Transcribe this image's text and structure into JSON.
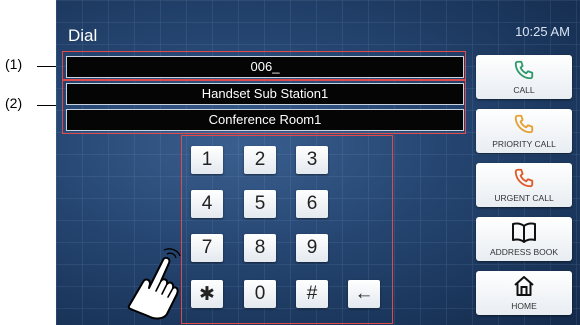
{
  "screen": {
    "title": "Dial",
    "time": "10:25 AM"
  },
  "fields": {
    "number": "006_",
    "station_name": "Handset Sub Station1",
    "room_name": "Conference Room1"
  },
  "callouts": {
    "label1": "(1)",
    "label2": "(2)"
  },
  "keypad": {
    "k1": "1",
    "k2": "2",
    "k3": "3",
    "k4": "4",
    "k5": "5",
    "k6": "6",
    "k7": "7",
    "k8": "8",
    "k9": "9",
    "kstar": "✱",
    "k0": "0",
    "khash": "#",
    "kback": "←"
  },
  "side_buttons": {
    "call": "CALL",
    "priority": "PRIORITY CALL",
    "urgent": "URGENT CALL",
    "address": "ADDRESS BOOK",
    "home": "HOME"
  },
  "colors": {
    "call_icon": "#2e9a6a",
    "priority_icon": "#e5a030",
    "urgent_icon": "#e05a2a",
    "highlight": "#e04a4a"
  }
}
